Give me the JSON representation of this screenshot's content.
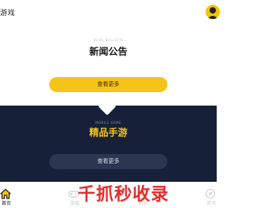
{
  "header": {
    "logo_text": "游戏"
  },
  "news": {
    "subtitle": "NEWS BULLETIN",
    "title": "新闻公告",
    "button_label": "查看更多"
  },
  "games": {
    "subtitle": "MOBILE GAME",
    "title": "精品手游",
    "button_label": "查看更多"
  },
  "bottom_nav": {
    "items": [
      {
        "label": "首页",
        "icon": "home-icon",
        "active": true
      },
      {
        "label": "游戏",
        "icon": "gamepad-icon",
        "active": false
      },
      {
        "label": "礼包",
        "icon": "gift-icon",
        "active": false
      },
      {
        "label": "资讯",
        "icon": "compass-icon",
        "active": false
      }
    ]
  },
  "watermark": {
    "text": "千抓秒收录"
  },
  "colors": {
    "accent": "#f6c419",
    "dark_panel": "#162038",
    "watermark": "#e62d2d"
  }
}
